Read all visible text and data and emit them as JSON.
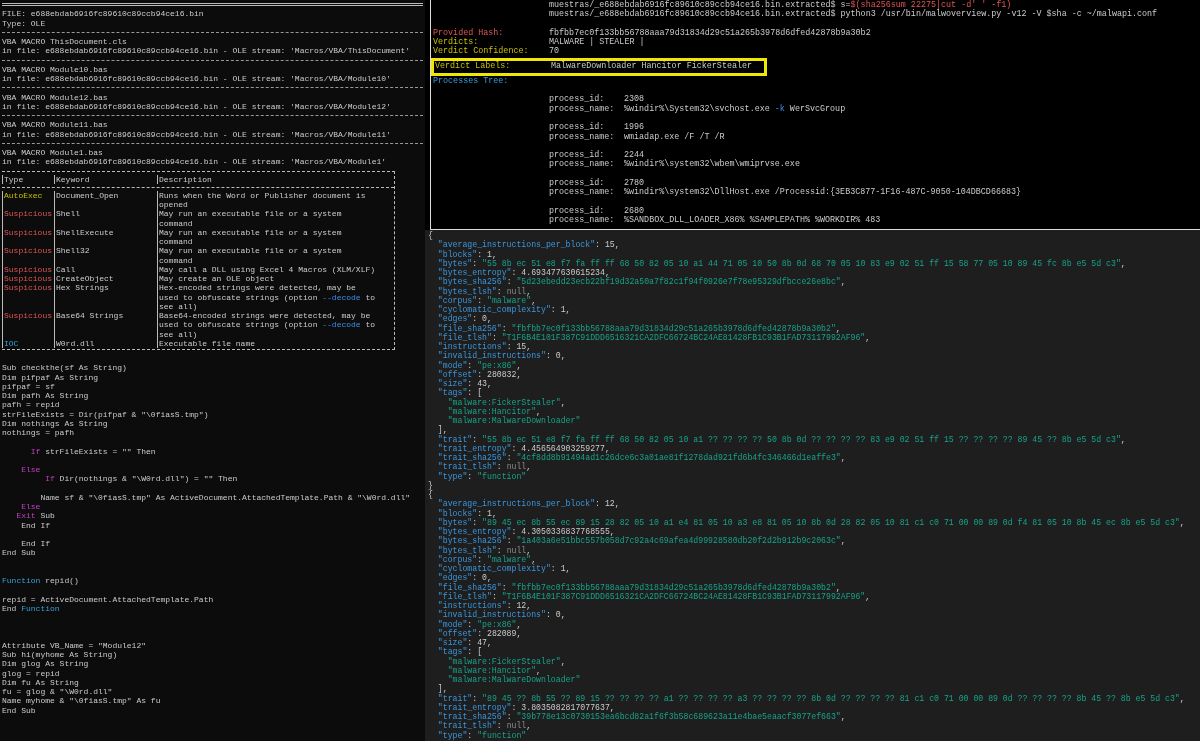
{
  "left": {
    "header": [
      {
        "kind": "double_rule"
      },
      "FILE: e688ebdab6916fc89610c89ccb94ce16.bin",
      "Type: OLE",
      {
        "kind": "rule"
      },
      "VBA MACRO ThisDocument.cls",
      "in file: e688ebdab6916fc89610c89ccb94ce16.bin - OLE stream: 'Macros/VBA/ThisDocument'",
      {
        "kind": "rule"
      },
      "VBA MACRO Module10.bas",
      "in file: e688ebdab6916fc89610c89ccb94ce16.bin - OLE stream: 'Macros/VBA/Module10'",
      {
        "kind": "rule"
      },
      "VBA MACRO Module12.bas",
      "in file: e688ebdab6916fc89610c89ccb94ce16.bin - OLE stream: 'Macros/VBA/Module12'",
      {
        "kind": "rule"
      },
      "VBA MACRO Module11.bas",
      "in file: e688ebdab6916fc89610c89ccb94ce16.bin - OLE stream: 'Macros/VBA/Module11'",
      {
        "kind": "rule"
      },
      "VBA MACRO Module1.bas",
      "in file: e688ebdab6916fc89610c89ccb94ce16.bin - OLE stream: 'Macros/VBA/Module1'"
    ],
    "table": {
      "columns": [
        "Type",
        "Keyword",
        "Description"
      ],
      "rows": [
        {
          "kind": "autoexec",
          "type": "AutoExec",
          "keyword": "Document_Open",
          "description": [
            "Runs when the Word or Publisher document is",
            "opened"
          ]
        },
        {
          "kind": "suspicious",
          "type": "Suspicious",
          "keyword": "Shell",
          "description": [
            "May run an executable file or a system",
            "command"
          ]
        },
        {
          "kind": "suspicious",
          "type": "Suspicious",
          "keyword": "ShellExecute",
          "description": [
            "May run an executable file or a system",
            "command"
          ]
        },
        {
          "kind": "suspicious",
          "type": "Suspicious",
          "keyword": "Shell32",
          "description": [
            "May run an executable file or a system",
            "command"
          ]
        },
        {
          "kind": "suspicious",
          "type": "Suspicious",
          "keyword": "Call",
          "description": [
            "May call a DLL using Excel 4 Macros (XLM/XLF)"
          ]
        },
        {
          "kind": "suspicious",
          "type": "Suspicious",
          "keyword": "CreateObject",
          "description": [
            "May create an OLE object"
          ]
        },
        {
          "kind": "suspicious",
          "type": "Suspicious",
          "keyword": "Hex Strings",
          "description": [
            "Hex-encoded strings were detected, may be",
            [
              {
                "kind": "plain",
                "text": "used to obfuscate strings (option "
              },
              {
                "kind": "flag",
                "text": "--decode"
              },
              {
                "kind": "plain",
                "text": " to"
              }
            ],
            "see all)"
          ]
        },
        {
          "kind": "suspicious",
          "type": "Suspicious",
          "keyword": "Base64 Strings",
          "description": [
            "Base64-encoded strings were detected, may be",
            [
              {
                "kind": "plain",
                "text": "used to obfuscate strings (option "
              },
              {
                "kind": "flag",
                "text": "--decode"
              },
              {
                "kind": "plain",
                "text": " to"
              }
            ],
            "see all)"
          ]
        },
        {
          "kind": "ioc",
          "type": "IOC",
          "keyword": "W0rd.dll",
          "description": [
            "Executable file name"
          ]
        }
      ]
    },
    "code": [
      {
        "kind": "blank"
      },
      "Sub checkthe(sf As String)",
      "Dim pifpaf As String",
      "pifpaf = sf",
      "Dim pafh As String",
      "pafh = repid",
      "strFileExists = Dir(pifpaf & \"\\0fiasS.tmp\")",
      "Dim nothings As String",
      "nothings = pafh",
      {
        "kind": "blank"
      },
      [
        {
          "kind": "keyword",
          "text": "      If"
        },
        {
          "kind": "plain",
          "text": " strFileExists = \"\" Then"
        }
      ],
      {
        "kind": "blank"
      },
      [
        {
          "kind": "keyword",
          "text": "    Else"
        }
      ],
      [
        {
          "kind": "keyword",
          "text": "         If"
        },
        {
          "kind": "plain",
          "text": " Dir(nothings & \"\\W0rd.dll\") = \"\" Then"
        }
      ],
      {
        "kind": "blank"
      },
      "        Name sf & \"\\0fiasS.tmp\" As ActiveDocument.AttachedTemplate.Path & \"\\W0rd.dll\"",
      [
        {
          "kind": "keyword",
          "text": "    Else"
        }
      ],
      [
        {
          "kind": "keyword",
          "text": "   Exit"
        },
        {
          "kind": "plain",
          "text": " Sub"
        }
      ],
      "    End If",
      {
        "kind": "blank"
      },
      "    End If",
      "End Sub",
      {
        "kind": "blank"
      },
      {
        "kind": "blank"
      },
      [
        {
          "kind": "function",
          "text": "Function"
        },
        {
          "kind": "plain",
          "text": " repid()"
        }
      ],
      {
        "kind": "blank"
      },
      "repid = ActiveDocument.AttachedTemplate.Path",
      [
        {
          "kind": "plain",
          "text": "End "
        },
        {
          "kind": "function",
          "text": "Function"
        }
      ],
      {
        "kind": "blank"
      },
      {
        "kind": "blank"
      },
      {
        "kind": "blank"
      },
      "Attribute VB_Name = \"Module12\"",
      "Sub hi(myhome As String)",
      "Dim glog As String",
      "glog = repid",
      "Dim fu As String",
      "fu = glog & \"\\W0rd.dll\"",
      "Name myhome & \"\\0fiasS.tmp\" As fu",
      "End Sub"
    ]
  },
  "terminal": {
    "prompts": [
      [
        {
          "kind": "plain",
          "text": "muestras/_e688ebdab6916fc89610c89ccb94ce16.bin.extracted$ s="
        },
        {
          "kind": "error",
          "text": "$(sha256sum 22275|cut -d' ' -f1)"
        }
      ],
      "muestras/_e688ebdab6916fc89610c89ccb94ce16.bin.extracted$ python3 /usr/bin/malwoverview.py -v12 -V $sha -c ~/malwapi.conf"
    ],
    "summary": [
      {
        "kind": "hash",
        "label": "Provided Hash:",
        "value": "fbfbb7ec0f133bb56788aaa79d31834d29c51a265b3978d6dfed42878b9a30b2",
        "highlighted": false
      },
      {
        "kind": "verdict",
        "label": "Verdicts:",
        "value": "MALWARE | STEALER |",
        "highlighted": false
      },
      {
        "kind": "verdict",
        "label": "Verdict Confidence:",
        "value": "70",
        "highlighted": false
      },
      {
        "kind": "verdict",
        "label": "Verdict Labels:",
        "value": "MalwareDownloader Hancitor FickerStealer",
        "highlighted": true
      }
    ],
    "processes_title": "Processes Tree:",
    "processes": [
      {
        "id_label": "process_id:",
        "id": "2308",
        "name_label": "process_name:",
        "name": [
          {
            "kind": "plain",
            "text": "%windir%\\System32\\svchost.exe "
          },
          {
            "kind": "flag",
            "text": "-k"
          },
          {
            "kind": "plain",
            "text": " WerSvcGroup"
          }
        ]
      },
      {
        "id_label": "process_id:",
        "id": "1996",
        "name_label": "process_name:",
        "name": "wmiadap.exe /F /T /R"
      },
      {
        "id_label": "process_id:",
        "id": "2244",
        "name_label": "process_name:",
        "name": "%windir%\\system32\\wbem\\wmiprvse.exe"
      },
      {
        "id_label": "process_id:",
        "id": "2780",
        "name_label": "process_name:",
        "name": "%windir%\\system32\\DllHost.exe /Processid:{3EB3C877-1F16-487C-9050-104DBCD66683}"
      },
      {
        "id_label": "process_id:",
        "id": "2680",
        "name_label": "process_name:",
        "name": "%SANDBOX_DLL_LOADER_X86% %SAMPLEPATH% %WORKDIR% 483"
      }
    ]
  },
  "json_output": [
    "{",
    [
      {
        "kind": "key",
        "text": "  \"average_instructions_per_block\""
      },
      {
        "kind": "plain",
        "text": ": 15,"
      }
    ],
    [
      {
        "kind": "key",
        "text": "  \"blocks\""
      },
      {
        "kind": "plain",
        "text": ": 1,"
      }
    ],
    [
      {
        "kind": "key",
        "text": "  \"bytes\""
      },
      {
        "kind": "plain",
        "text": ": "
      },
      {
        "kind": "string",
        "text": "\"55 8b ec 51 e8 f7 fa ff ff 68 50 82 05 10 a1 44 71 05 10 50 8b 0d 68 70 05 10 83 e9 02 51 ff 15 58 77 05 10 89 45 fc 8b e5 5d c3\""
      },
      {
        "kind": "plain",
        "text": ","
      }
    ],
    [
      {
        "kind": "key",
        "text": "  \"bytes_entropy\""
      },
      {
        "kind": "plain",
        "text": ": 4.693477630615234,"
      }
    ],
    [
      {
        "kind": "key",
        "text": "  \"bytes_sha256\""
      },
      {
        "kind": "plain",
        "text": ": "
      },
      {
        "kind": "string",
        "text": "\"5d23ebedd23ecb22bf19d32a50a7f82c1f94f0926e7f78e95329dfbcce26e8bc\""
      },
      {
        "kind": "plain",
        "text": ","
      }
    ],
    [
      {
        "kind": "key",
        "text": "  \"bytes_tlsh\""
      },
      {
        "kind": "plain",
        "text": ": "
      },
      {
        "kind": "null",
        "text": "null"
      },
      {
        "kind": "plain",
        "text": ","
      }
    ],
    [
      {
        "kind": "key",
        "text": "  \"corpus\""
      },
      {
        "kind": "plain",
        "text": ": "
      },
      {
        "kind": "string",
        "text": "\"malware\""
      },
      {
        "kind": "plain",
        "text": ","
      }
    ],
    [
      {
        "kind": "key",
        "text": "  \"cyclomatic_complexity\""
      },
      {
        "kind": "plain",
        "text": ": 1,"
      }
    ],
    [
      {
        "kind": "key",
        "text": "  \"edges\""
      },
      {
        "kind": "plain",
        "text": ": 0,"
      }
    ],
    [
      {
        "kind": "key",
        "text": "  \"file_sha256\""
      },
      {
        "kind": "plain",
        "text": ": "
      },
      {
        "kind": "string",
        "text": "\"fbfbb7ec0f133bb56788aaa79d31834d29c51a265b3978d6dfed42878b9a30b2\""
      },
      {
        "kind": "plain",
        "text": ","
      }
    ],
    [
      {
        "kind": "key",
        "text": "  \"file_tlsh\""
      },
      {
        "kind": "plain",
        "text": ": "
      },
      {
        "kind": "string",
        "text": "\"T1F6B4E101F387C91DDD6516321CA2DFC66724BC24AE81428FB1C93B1FAD73117992AF96\""
      },
      {
        "kind": "plain",
        "text": ","
      }
    ],
    [
      {
        "kind": "key",
        "text": "  \"instructions\""
      },
      {
        "kind": "plain",
        "text": ": 15,"
      }
    ],
    [
      {
        "kind": "key",
        "text": "  \"invalid_instructions\""
      },
      {
        "kind": "plain",
        "text": ": 0,"
      }
    ],
    [
      {
        "kind": "key",
        "text": "  \"mode\""
      },
      {
        "kind": "plain",
        "text": ": "
      },
      {
        "kind": "string",
        "text": "\"pe:x86\""
      },
      {
        "kind": "plain",
        "text": ","
      }
    ],
    [
      {
        "kind": "key",
        "text": "  \"offset\""
      },
      {
        "kind": "plain",
        "text": ": 280832,"
      }
    ],
    [
      {
        "kind": "key",
        "text": "  \"size\""
      },
      {
        "kind": "plain",
        "text": ": 43,"
      }
    ],
    [
      {
        "kind": "key",
        "text": "  \"tags\""
      },
      {
        "kind": "plain",
        "text": ": ["
      }
    ],
    [
      {
        "kind": "string",
        "text": "    \"malware:FickerStealer\""
      },
      {
        "kind": "plain",
        "text": ","
      }
    ],
    [
      {
        "kind": "string",
        "text": "    \"malware:Hancitor\""
      },
      {
        "kind": "plain",
        "text": ","
      }
    ],
    [
      {
        "kind": "string",
        "text": "    \"malware:MalwareDownloader\""
      }
    ],
    "  ],",
    [
      {
        "kind": "key",
        "text": "  \"trait\""
      },
      {
        "kind": "plain",
        "text": ": "
      },
      {
        "kind": "string",
        "text": "\"55 8b ec 51 e8 f7 fa ff ff 68 50 82 05 10 a1 ?? ?? ?? ?? 50 8b 0d ?? ?? ?? ?? 83 e9 02 51 ff 15 ?? ?? ?? ?? 89 45 ?? 8b e5 5d c3\""
      },
      {
        "kind": "plain",
        "text": ","
      }
    ],
    [
      {
        "kind": "key",
        "text": "  \"trait_entropy\""
      },
      {
        "kind": "plain",
        "text": ": 4.456564903259277,"
      }
    ],
    [
      {
        "kind": "key",
        "text": "  \"trait_sha256\""
      },
      {
        "kind": "plain",
        "text": ": "
      },
      {
        "kind": "string",
        "text": "\"4cf8dd8b91494ad1c26dce6c3a01ae81f1278dad921fd6b4fc346466d1eaffe3\""
      },
      {
        "kind": "plain",
        "text": ","
      }
    ],
    [
      {
        "kind": "key",
        "text": "  \"trait_tlsh\""
      },
      {
        "kind": "plain",
        "text": ": "
      },
      {
        "kind": "null",
        "text": "null"
      },
      {
        "kind": "plain",
        "text": ","
      }
    ],
    [
      {
        "kind": "key",
        "text": "  \"type\""
      },
      {
        "kind": "plain",
        "text": ": "
      },
      {
        "kind": "string",
        "text": "\"function\""
      }
    ],
    "}",
    "{",
    [
      {
        "kind": "key",
        "text": "  \"average_instructions_per_block\""
      },
      {
        "kind": "plain",
        "text": ": 12,"
      }
    ],
    [
      {
        "kind": "key",
        "text": "  \"blocks\""
      },
      {
        "kind": "plain",
        "text": ": 1,"
      }
    ],
    [
      {
        "kind": "key",
        "text": "  \"bytes\""
      },
      {
        "kind": "plain",
        "text": ": "
      },
      {
        "kind": "string",
        "text": "\"89 45 ec 8b 55 ec 89 15 28 82 05 10 a1 e4 81 05 10 a3 e8 81 05 10 8b 0d 28 82 05 10 81 c1 c0 71 00 00 89 0d f4 81 05 10 8b 45 ec 8b e5 5d c3\""
      },
      {
        "kind": "plain",
        "text": ","
      }
    ],
    [
      {
        "kind": "key",
        "text": "  \"bytes_entropy\""
      },
      {
        "kind": "plain",
        "text": ": 4.3050336837768555,"
      }
    ],
    [
      {
        "kind": "key",
        "text": "  \"bytes_sha256\""
      },
      {
        "kind": "plain",
        "text": ": "
      },
      {
        "kind": "string",
        "text": "\"1a403a6e51bbc557b058d7c92a4c69afea4d99928580db20f2d2b912b9c2063c\""
      },
      {
        "kind": "plain",
        "text": ","
      }
    ],
    [
      {
        "kind": "key",
        "text": "  \"bytes_tlsh\""
      },
      {
        "kind": "plain",
        "text": ": "
      },
      {
        "kind": "null",
        "text": "null"
      },
      {
        "kind": "plain",
        "text": ","
      }
    ],
    [
      {
        "kind": "key",
        "text": "  \"corpus\""
      },
      {
        "kind": "plain",
        "text": ": "
      },
      {
        "kind": "string",
        "text": "\"malware\""
      },
      {
        "kind": "plain",
        "text": ","
      }
    ],
    [
      {
        "kind": "key",
        "text": "  \"cyclomatic_complexity\""
      },
      {
        "kind": "plain",
        "text": ": 1,"
      }
    ],
    [
      {
        "kind": "key",
        "text": "  \"edges\""
      },
      {
        "kind": "plain",
        "text": ": 0,"
      }
    ],
    [
      {
        "kind": "key",
        "text": "  \"file_sha256\""
      },
      {
        "kind": "plain",
        "text": ": "
      },
      {
        "kind": "string",
        "text": "\"fbfbb7ec0f133bb56788aaa79d31834d29c51a265b3978d6dfed42878b9a30b2\""
      },
      {
        "kind": "plain",
        "text": ","
      }
    ],
    [
      {
        "kind": "key",
        "text": "  \"file_tlsh\""
      },
      {
        "kind": "plain",
        "text": ": "
      },
      {
        "kind": "string",
        "text": "\"T1F6B4E101F387C91DDD6516321CA2DFC66724BC24AE81428FB1C93B1FAD73117992AF96\""
      },
      {
        "kind": "plain",
        "text": ","
      }
    ],
    [
      {
        "kind": "key",
        "text": "  \"instructions\""
      },
      {
        "kind": "plain",
        "text": ": 12,"
      }
    ],
    [
      {
        "kind": "key",
        "text": "  \"invalid_instructions\""
      },
      {
        "kind": "plain",
        "text": ": 0,"
      }
    ],
    [
      {
        "kind": "key",
        "text": "  \"mode\""
      },
      {
        "kind": "plain",
        "text": ": "
      },
      {
        "kind": "string",
        "text": "\"pe:x86\""
      },
      {
        "kind": "plain",
        "text": ","
      }
    ],
    [
      {
        "kind": "key",
        "text": "  \"offset\""
      },
      {
        "kind": "plain",
        "text": ": 282089,"
      }
    ],
    [
      {
        "kind": "key",
        "text": "  \"size\""
      },
      {
        "kind": "plain",
        "text": ": 47,"
      }
    ],
    [
      {
        "kind": "key",
        "text": "  \"tags\""
      },
      {
        "kind": "plain",
        "text": ": ["
      }
    ],
    [
      {
        "kind": "string",
        "text": "    \"malware:FickerStealer\""
      },
      {
        "kind": "plain",
        "text": ","
      }
    ],
    [
      {
        "kind": "string",
        "text": "    \"malware:Hancitor\""
      },
      {
        "kind": "plain",
        "text": ","
      }
    ],
    [
      {
        "kind": "string",
        "text": "    \"malware:MalwareDownloader\""
      }
    ],
    "  ],",
    [
      {
        "kind": "key",
        "text": "  \"trait\""
      },
      {
        "kind": "plain",
        "text": ": "
      },
      {
        "kind": "string",
        "text": "\"89 45 ?? 8b 55 ?? 89 15 ?? ?? ?? ?? a1 ?? ?? ?? ?? a3 ?? ?? ?? ?? 8b 0d ?? ?? ?? ?? 81 c1 c0 71 00 00 89 0d ?? ?? ?? ?? 8b 45 ?? 8b e5 5d c3\""
      },
      {
        "kind": "plain",
        "text": ","
      }
    ],
    [
      {
        "kind": "key",
        "text": "  \"trait_entropy\""
      },
      {
        "kind": "plain",
        "text": ": 3.8035082817077637,"
      }
    ],
    [
      {
        "kind": "key",
        "text": "  \"trait_sha256\""
      },
      {
        "kind": "plain",
        "text": ": "
      },
      {
        "kind": "string",
        "text": "\"39b778e13c0730153ea6bcd82a1f6f3b58c689623a11e4bae5eaacf3077ef663\""
      },
      {
        "kind": "plain",
        "text": ","
      }
    ],
    [
      {
        "kind": "key",
        "text": "  \"trait_tlsh\""
      },
      {
        "kind": "plain",
        "text": ": "
      },
      {
        "kind": "null",
        "text": "null"
      },
      {
        "kind": "plain",
        "text": ","
      }
    ],
    [
      {
        "kind": "key",
        "text": "  \"type\""
      },
      {
        "kind": "plain",
        "text": ": "
      },
      {
        "kind": "string",
        "text": "\"function\""
      }
    ]
  ]
}
